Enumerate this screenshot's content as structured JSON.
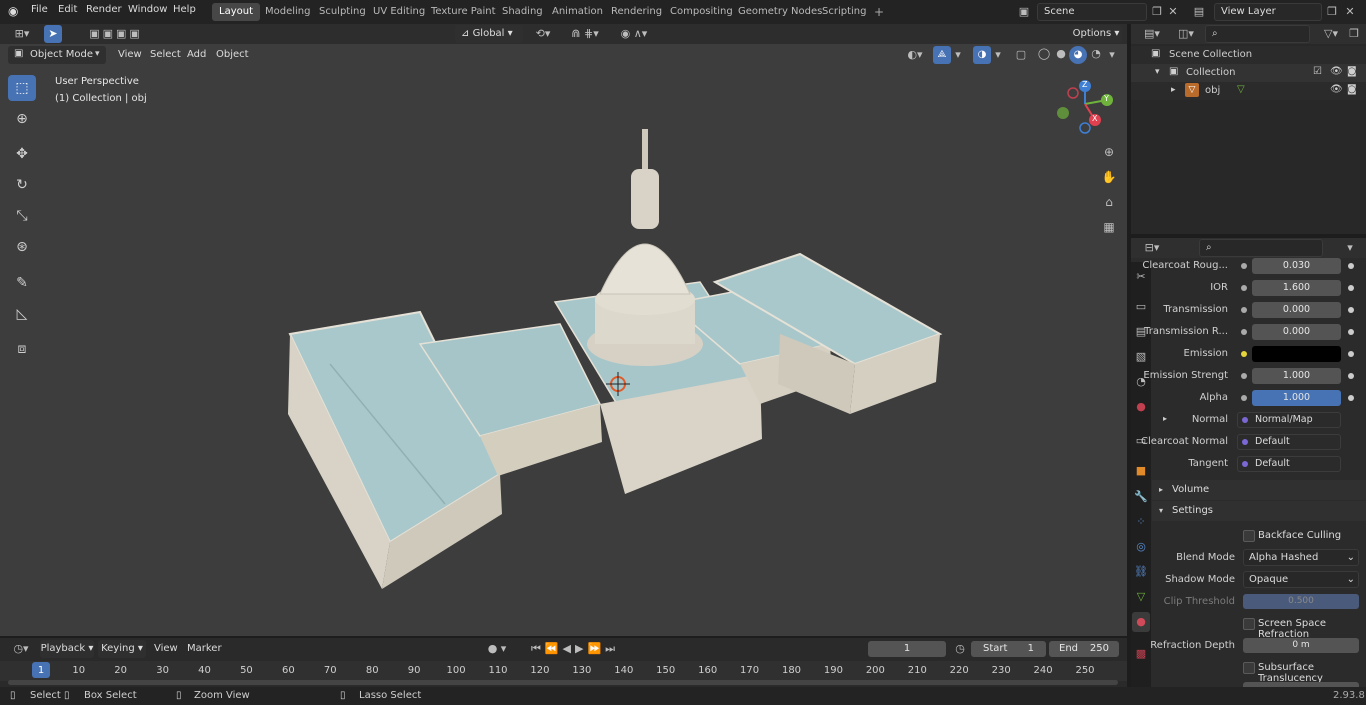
{
  "menu": {
    "file": "File",
    "edit": "Edit",
    "render": "Render",
    "window": "Window",
    "help": "Help"
  },
  "workspaces": [
    "Layout",
    "Modeling",
    "Sculpting",
    "UV Editing",
    "Texture Paint",
    "Shading",
    "Animation",
    "Rendering",
    "Compositing",
    "Geometry Nodes",
    "Scripting"
  ],
  "scene": {
    "name": "Scene",
    "view_layer": "View Layer"
  },
  "viewport": {
    "mode": "Object Mode",
    "menu_view": "View",
    "menu_select": "Select",
    "menu_add": "Add",
    "menu_object": "Object",
    "transform": "Global",
    "options": "Options",
    "info_line1": "User Perspective",
    "info_line2": "(1) Collection | obj",
    "gizmo_x": "X",
    "gizmo_y": "Y",
    "gizmo_z": "Z"
  },
  "outliner": {
    "scene_collection": "Scene Collection",
    "collection": "Collection",
    "obj": "obj"
  },
  "properties": {
    "rows": [
      {
        "label": "Clearcoat Roug...",
        "value": "0.030"
      },
      {
        "label": "IOR",
        "value": "1.600"
      },
      {
        "label": "Transmission",
        "value": "0.000"
      },
      {
        "label": "Transmission R...",
        "value": "0.000"
      },
      {
        "label": "Emission",
        "value": ""
      },
      {
        "label": "Emission Strengt",
        "value": "1.000"
      },
      {
        "label": "Alpha",
        "value": "1.000"
      }
    ],
    "normal_label": "Normal",
    "normal_value": "Normal/Map",
    "clearcoat_normal_label": "Clearcoat Normal",
    "clearcoat_normal_value": "Default",
    "tangent_label": "Tangent",
    "tangent_value": "Default",
    "volume": "Volume",
    "settings": "Settings",
    "backface": "Backface Culling",
    "blend_mode_label": "Blend Mode",
    "blend_mode_value": "Alpha Hashed",
    "shadow_mode_label": "Shadow Mode",
    "shadow_mode_value": "Opaque",
    "clip_label": "Clip Threshold",
    "clip_value": "0.500",
    "ssr": "Screen Space Refraction",
    "refraction_label": "Refraction Depth",
    "refraction_value": "0 m",
    "sss": "Subsurface Translucency"
  },
  "timeline": {
    "playback": "Playback",
    "keying": "Keying",
    "view": "View",
    "marker": "Marker",
    "current_frame": "1",
    "start_label": "Start",
    "start_value": "1",
    "end_label": "End",
    "end_value": "250",
    "ticks": [
      "1",
      "10",
      "20",
      "30",
      "40",
      "50",
      "60",
      "70",
      "80",
      "90",
      "100",
      "110",
      "120",
      "130",
      "140",
      "150",
      "160",
      "170",
      "180",
      "190",
      "200",
      "210",
      "220",
      "230",
      "240",
      "250"
    ]
  },
  "status": {
    "select": "Select",
    "box_select": "Box Select",
    "zoom_view": "Zoom View",
    "lasso_select": "Lasso Select",
    "version": "2.93.8"
  },
  "colors": {
    "accent": "#4772b3",
    "viewport_bg": "#3d3d3d",
    "roof": "#a9c8cc",
    "wall": "#d9d4c8",
    "gizmo_x": "#e0404f",
    "gizmo_y": "#6fb33c",
    "gizmo_z": "#3f7fd4",
    "emission": "#000000"
  }
}
